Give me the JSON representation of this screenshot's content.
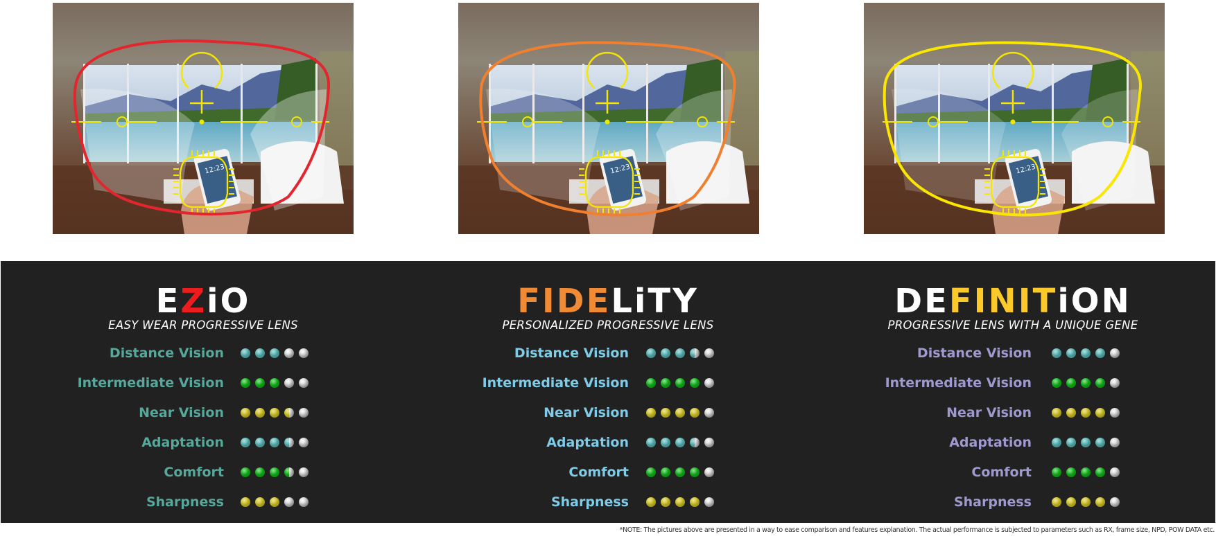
{
  "photos": [
    {
      "name": "ezio",
      "frame_color": "#e3262e",
      "phone_time": "12:23"
    },
    {
      "name": "fidelity",
      "frame_color": "#f08030",
      "phone_time": "12:23"
    },
    {
      "name": "definition",
      "frame_color": "#fae600",
      "phone_time": "12:23"
    }
  ],
  "overlay_color": "#f4e600",
  "categories": [
    "Distance Vision",
    "Intermediate Vision",
    "Near Vision",
    "Adaptation",
    "Comfort",
    "Sharpness"
  ],
  "category_dot_colors": [
    "#5ab8b8",
    "#12b81a",
    "#d4c626",
    "#5ab8b8",
    "#12b81a",
    "#d4c626"
  ],
  "empty_dot_color": "#c8c8c8",
  "max_rating": 5,
  "products": [
    {
      "logo_parts": [
        {
          "text": "E",
          "color": "#ffffff"
        },
        {
          "text": "Z",
          "color": "#ee1c1c"
        },
        {
          "text": "iO",
          "color": "#ffffff"
        }
      ],
      "tagline": "EASY WEAR PROGRESSIVE LENS",
      "label_color": "#56a89a",
      "ratings": [
        3,
        3,
        3.5,
        3.5,
        3.5,
        3
      ]
    },
    {
      "logo_parts": [
        {
          "text": "FIDE",
          "color": "#f08a34"
        },
        {
          "text": "LiTY",
          "color": "#ffffff"
        }
      ],
      "tagline": "PERSONALIZED PROGRESSIVE LENS",
      "label_color": "#7fcce8",
      "ratings": [
        3.5,
        4,
        4,
        3.5,
        4,
        4
      ]
    },
    {
      "logo_parts": [
        {
          "text": "DE",
          "color": "#ffffff"
        },
        {
          "text": "FINIT",
          "color": "#fbc92a"
        },
        {
          "text": "iON",
          "color": "#ffffff"
        }
      ],
      "tagline": "PROGRESSIVE LENS WITH A UNIQUE GENE",
      "label_color": "#9e9ad0",
      "ratings": [
        4,
        4,
        4,
        4,
        4,
        4
      ]
    }
  ],
  "footnote": "*NOTE: The pictures above are presented in a way to ease comparison and features explanation. The actual performance is subjected to parameters such as RX, frame size, NPD, POW DATA etc."
}
